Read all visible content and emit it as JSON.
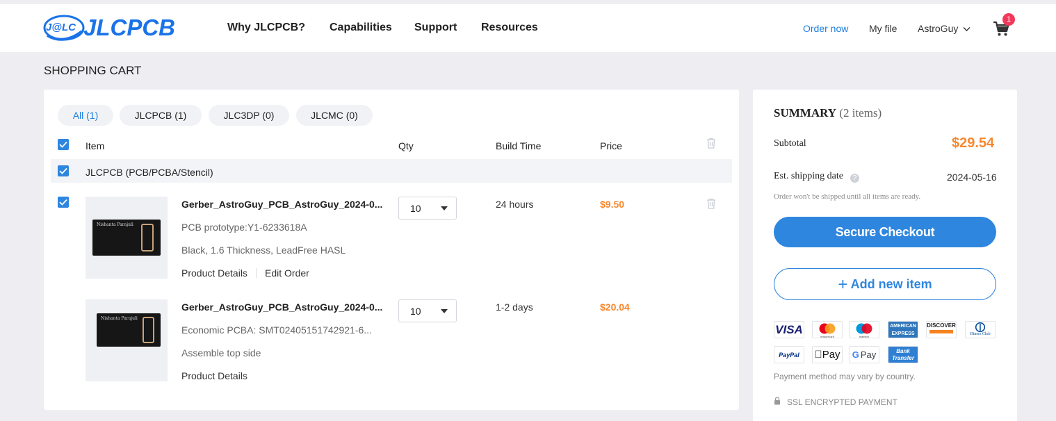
{
  "header": {
    "logo_badge": "J@LC",
    "logo_text": "JLCPCB",
    "nav": [
      "Why JLCPCB?",
      "Capabilities",
      "Support",
      "Resources"
    ],
    "order_now": "Order now",
    "my_file": "My file",
    "user": "AstroGuy",
    "cart_count": "1"
  },
  "page_title": "SHOPPING CART",
  "tabs": [
    {
      "label": "All  (1)",
      "active": true
    },
    {
      "label": "JLCPCB  (1)",
      "active": false
    },
    {
      "label": "JLC3DP  (0)",
      "active": false
    },
    {
      "label": "JLCMC  (0)",
      "active": false
    }
  ],
  "columns": {
    "item": "Item",
    "qty": "Qty",
    "build_time": "Build Time",
    "price": "Price"
  },
  "group_label": "JLCPCB (PCB/PCBA/Stencil)",
  "items": [
    {
      "checked": true,
      "title": "Gerber_AstroGuy_PCB_AstroGuy_2024-0...",
      "sub1": "PCB prototype:Y1-6233618A",
      "sub2": "Black, 1.6 Thickness, LeadFree HASL",
      "link1": "Product Details",
      "link2": "Edit Order",
      "qty": "10",
      "build_time": "24 hours",
      "price": "$9.50",
      "board_name": "Nishanta Parajuli"
    },
    {
      "checked": false,
      "title": "Gerber_AstroGuy_PCB_AstroGuy_2024-0...",
      "sub1": "Economic PCBA: SMT02405151742921-6...",
      "sub2": "Assemble top side",
      "link1": "Product Details",
      "qty": "10",
      "build_time": "1-2 days",
      "price": "$20.04",
      "board_name": "Nishanta Parajuli"
    }
  ],
  "summary": {
    "title": "SUMMARY",
    "count": "(2 items)",
    "subtotal_label": "Subtotal",
    "subtotal": "$29.54",
    "ship_label": "Est. shipping date",
    "ship_date": "2024-05-16",
    "note": "Order won't be shipped until all items are ready.",
    "checkout": "Secure Checkout",
    "add_new": "Add new item",
    "pay_note": "Payment method may vary by country.",
    "ssl": "SSL ENCRYPTED PAYMENT"
  },
  "payments": [
    "VISA",
    "mastercard",
    "maestro",
    "AMERICAN EXPRESS",
    "DISCOVER",
    "Diners Club",
    "PayPal",
    "Pay",
    "Pay",
    "Bank Transfer"
  ],
  "colors": {
    "accent": "#2e86de",
    "price": "#f7882f",
    "badge": "#f2385a"
  }
}
